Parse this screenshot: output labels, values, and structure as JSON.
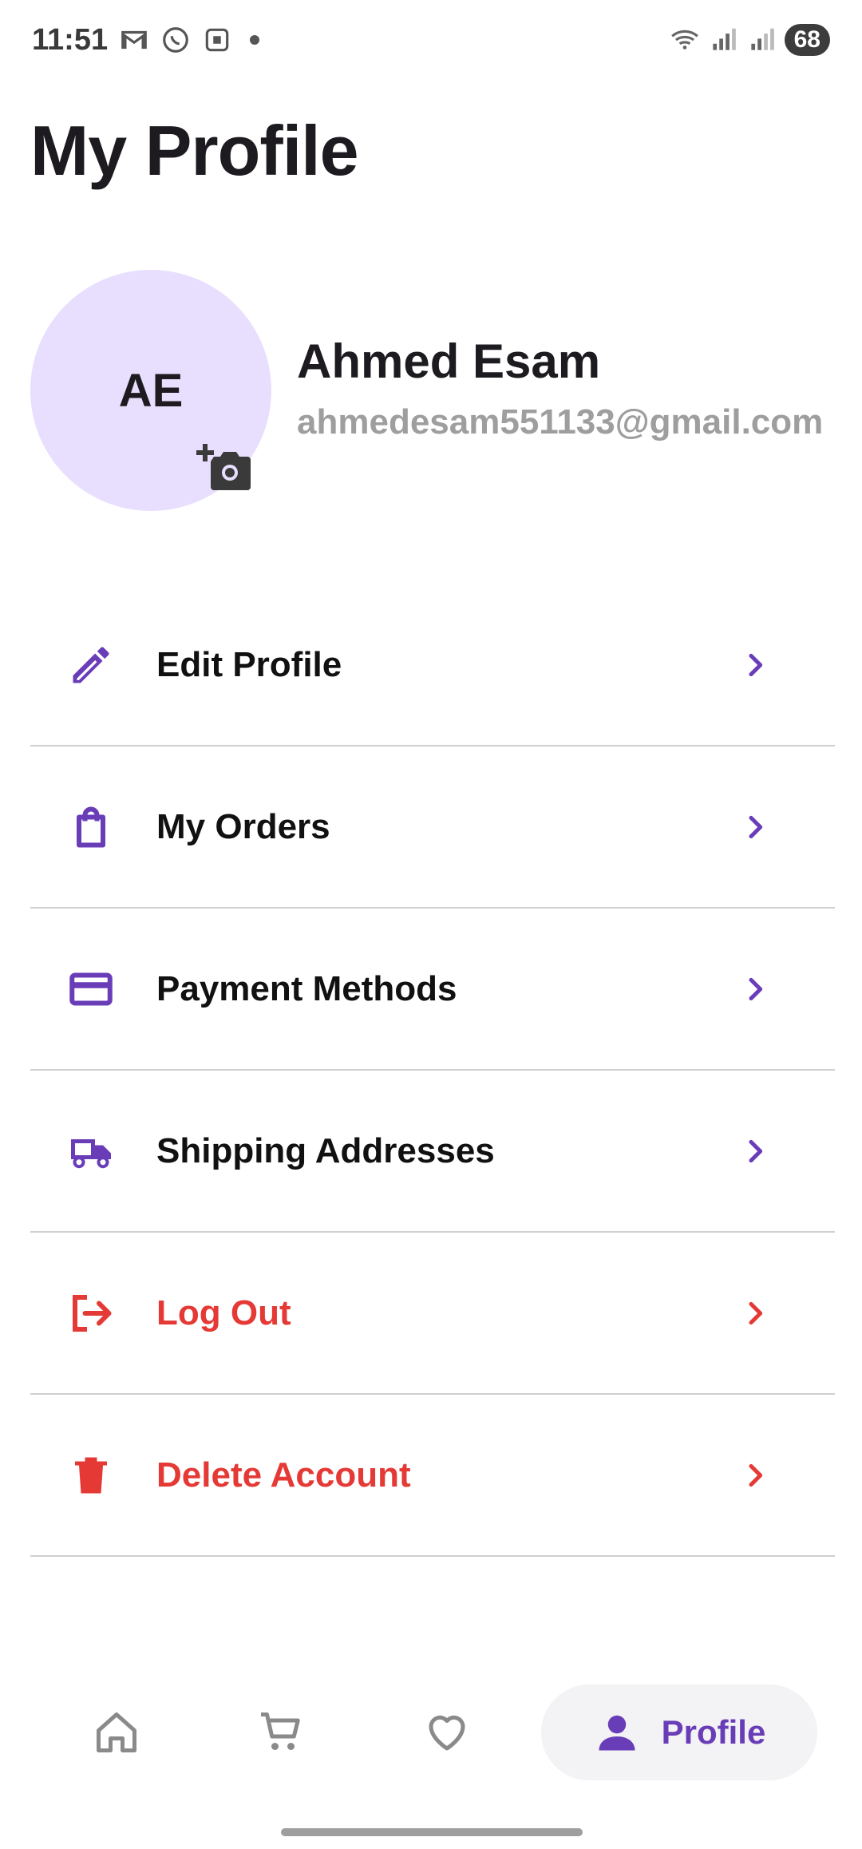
{
  "status_bar": {
    "time": "11:51",
    "battery": "68",
    "icons": [
      "gmail-icon",
      "whatsapp-icon",
      "screenshot-icon",
      "wifi-icon",
      "signal-icon",
      "signal-icon"
    ]
  },
  "page": {
    "title": "My Profile"
  },
  "profile": {
    "initials": "AE",
    "name": "Ahmed Esam",
    "email": "ahmedesam551133@gmail.com"
  },
  "menu": [
    {
      "label": "Edit Profile",
      "icon": "edit-icon",
      "danger": false
    },
    {
      "label": "My Orders",
      "icon": "shopping-bag-icon",
      "danger": false
    },
    {
      "label": "Payment Methods",
      "icon": "credit-card-icon",
      "danger": false
    },
    {
      "label": "Shipping Addresses",
      "icon": "truck-icon",
      "danger": false
    },
    {
      "label": "Log Out",
      "icon": "logout-icon",
      "danger": true
    },
    {
      "label": "Delete Account",
      "icon": "trash-icon",
      "danger": true
    }
  ],
  "bottom_nav": {
    "items": [
      {
        "icon": "home-icon"
      },
      {
        "icon": "cart-icon"
      },
      {
        "icon": "heart-icon"
      },
      {
        "icon": "person-icon",
        "label": "Profile",
        "active": true
      }
    ]
  },
  "colors": {
    "accent": "#6a3db8",
    "danger": "#e53935",
    "avatar_bg": "#e8defe",
    "muted_text": "#9e9e9e"
  }
}
